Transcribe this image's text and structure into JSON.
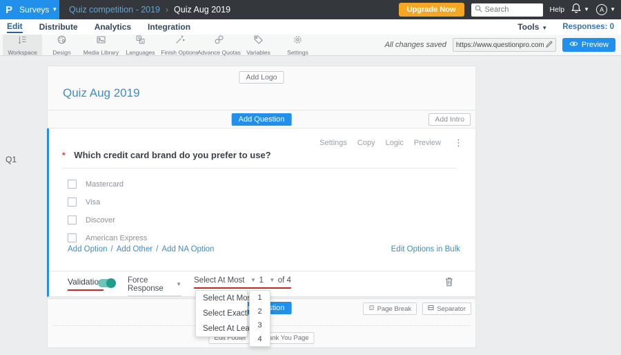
{
  "topbar": {
    "brand": {
      "logo": "P",
      "menu_label": "Surveys"
    },
    "breadcrumb": {
      "parent": "Quiz competition - 2019",
      "separator": "›",
      "current": "Quiz Aug 2019"
    },
    "upgrade_label": "Upgrade Now",
    "search": {
      "placeholder": "Search"
    },
    "help_label": "Help",
    "avatar_initial": "A"
  },
  "nav": {
    "items": [
      {
        "label": "Edit",
        "active": true
      },
      {
        "label": "Distribute",
        "active": false
      },
      {
        "label": "Analytics",
        "active": false
      },
      {
        "label": "Integration",
        "active": false
      }
    ],
    "tools_label": "Tools",
    "responses_label": "Responses: 0"
  },
  "toolbar": {
    "items": [
      {
        "label": "Workspace",
        "icon": "workspace-icon",
        "active": true
      },
      {
        "label": "Design",
        "icon": "design-icon",
        "active": false
      },
      {
        "label": "Media Library",
        "icon": "media-library-icon",
        "active": false
      },
      {
        "label": "Languages",
        "icon": "languages-icon",
        "active": false
      },
      {
        "label": "Finish Options",
        "icon": "finish-options-icon",
        "active": false
      },
      {
        "label": "Advance Quotas",
        "icon": "advance-quotas-icon",
        "active": false
      },
      {
        "label": "Variables",
        "icon": "variables-icon",
        "active": false
      },
      {
        "label": "Settings",
        "icon": "settings-icon",
        "active": false
      }
    ],
    "saved_status": "All changes saved",
    "survey_url": "https://www.questionpro.com/t/APNrFZ",
    "preview_label": "Preview"
  },
  "editor": {
    "add_logo_label": "Add Logo",
    "survey_title": "Quiz Aug 2019",
    "add_question_label": "Add Question",
    "add_intro_label": "Add Intro",
    "question": {
      "code": "Q1",
      "actions": [
        "Settings",
        "Copy",
        "Logic",
        "Preview"
      ],
      "required_marker": "*",
      "text": "Which credit card brand do you prefer to use?",
      "options": [
        "Mastercard",
        "Visa",
        "Discover",
        "American Express"
      ],
      "links": {
        "add_option": "Add Option",
        "sep": "/",
        "add_other": "Add Other",
        "add_na": "Add NA Option",
        "bulk": "Edit Options in Bulk"
      },
      "validation": {
        "label": "Validation",
        "force_response": "Force Response",
        "rule_selected": "Select At Most",
        "count_selected": "1",
        "of_total": "of 4"
      }
    },
    "rule_menu": [
      "Select At Most",
      "Select Exactly",
      "Select At Least"
    ],
    "count_menu": [
      "1",
      "2",
      "3",
      "4"
    ],
    "page_break_label": "Page Break",
    "separator_label": "Separator",
    "edit_footer_label": "Edit Footer",
    "thank_you_label": "Thank You Page"
  },
  "colors": {
    "accent_blue": "#2090ea",
    "topbar_bg": "#34383c",
    "upgrade_orange": "#f5a623",
    "toggle_teal": "#1f9e8e",
    "underline_red": "#c62828",
    "link_blue": "#3e8dc6"
  }
}
